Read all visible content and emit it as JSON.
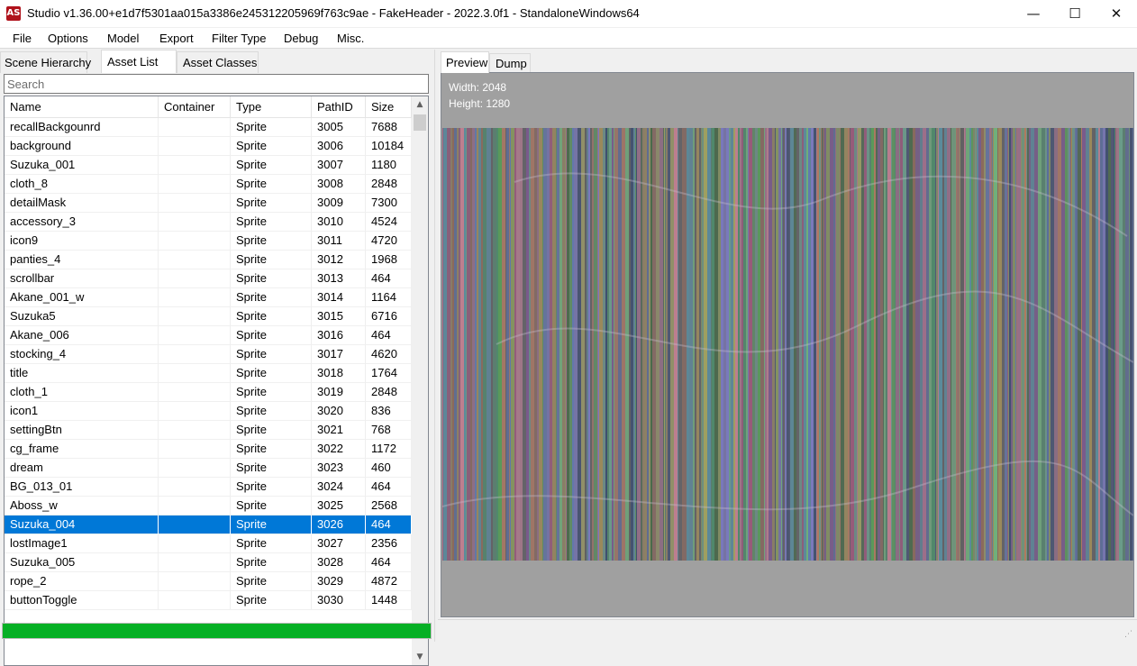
{
  "window": {
    "app_icon": "AS",
    "title": "Studio v1.36.00+e1d7f5301aa015a3386e245312205969f763c9ae - FakeHeader - 2022.3.0f1 - StandaloneWindows64",
    "minimize": "—",
    "maximize": "☐",
    "close": "✕"
  },
  "menu": [
    "File",
    "Options",
    "Model",
    "Export",
    "Filter Type",
    "Debug",
    "Misc."
  ],
  "left_tabs": [
    "Scene Hierarchy",
    "Asset List",
    "Asset Classes"
  ],
  "search": {
    "placeholder": "Search",
    "value": ""
  },
  "columns": [
    "Name",
    "Container",
    "Type",
    "PathID",
    "Size"
  ],
  "rows": [
    {
      "name": "recallBackgounrd",
      "container": "",
      "type": "Sprite",
      "pathid": "3005",
      "size": "7688"
    },
    {
      "name": "background",
      "container": "",
      "type": "Sprite",
      "pathid": "3006",
      "size": "10184"
    },
    {
      "name": "Suzuka_001",
      "container": "",
      "type": "Sprite",
      "pathid": "3007",
      "size": "1180"
    },
    {
      "name": "cloth_8",
      "container": "",
      "type": "Sprite",
      "pathid": "3008",
      "size": "2848"
    },
    {
      "name": "detailMask",
      "container": "",
      "type": "Sprite",
      "pathid": "3009",
      "size": "7300"
    },
    {
      "name": "accessory_3",
      "container": "",
      "type": "Sprite",
      "pathid": "3010",
      "size": "4524"
    },
    {
      "name": "icon9",
      "container": "",
      "type": "Sprite",
      "pathid": "3011",
      "size": "4720"
    },
    {
      "name": "panties_4",
      "container": "",
      "type": "Sprite",
      "pathid": "3012",
      "size": "1968"
    },
    {
      "name": "scrollbar",
      "container": "",
      "type": "Sprite",
      "pathid": "3013",
      "size": "464"
    },
    {
      "name": "Akane_001_w",
      "container": "",
      "type": "Sprite",
      "pathid": "3014",
      "size": "1164"
    },
    {
      "name": "Suzuka5",
      "container": "",
      "type": "Sprite",
      "pathid": "3015",
      "size": "6716"
    },
    {
      "name": "Akane_006",
      "container": "",
      "type": "Sprite",
      "pathid": "3016",
      "size": "464"
    },
    {
      "name": "stocking_4",
      "container": "",
      "type": "Sprite",
      "pathid": "3017",
      "size": "4620"
    },
    {
      "name": "title",
      "container": "",
      "type": "Sprite",
      "pathid": "3018",
      "size": "1764"
    },
    {
      "name": "cloth_1",
      "container": "",
      "type": "Sprite",
      "pathid": "3019",
      "size": "2848"
    },
    {
      "name": "icon1",
      "container": "",
      "type": "Sprite",
      "pathid": "3020",
      "size": "836"
    },
    {
      "name": "settingBtn",
      "container": "",
      "type": "Sprite",
      "pathid": "3021",
      "size": "768"
    },
    {
      "name": "cg_frame",
      "container": "",
      "type": "Sprite",
      "pathid": "3022",
      "size": "1172"
    },
    {
      "name": "dream",
      "container": "",
      "type": "Sprite",
      "pathid": "3023",
      "size": "460"
    },
    {
      "name": "BG_013_01",
      "container": "",
      "type": "Sprite",
      "pathid": "3024",
      "size": "464"
    },
    {
      "name": "Aboss_w",
      "container": "",
      "type": "Sprite",
      "pathid": "3025",
      "size": "2568"
    },
    {
      "name": "Suzuka_004",
      "container": "",
      "type": "Sprite",
      "pathid": "3026",
      "size": "464"
    },
    {
      "name": "lostImage1",
      "container": "",
      "type": "Sprite",
      "pathid": "3027",
      "size": "2356"
    },
    {
      "name": "Suzuka_005",
      "container": "",
      "type": "Sprite",
      "pathid": "3028",
      "size": "464"
    },
    {
      "name": "rope_2",
      "container": "",
      "type": "Sprite",
      "pathid": "3029",
      "size": "4872"
    },
    {
      "name": "buttonToggle",
      "container": "",
      "type": "Sprite",
      "pathid": "3030",
      "size": "1448"
    }
  ],
  "selected_row": 21,
  "scroll": {
    "up": "▲",
    "down": "▼"
  },
  "progress_fraction": 1.0,
  "progress_color": "#06b025",
  "right_tabs": [
    "Preview",
    "Dump"
  ],
  "preview": {
    "width_label": "Width: 2048",
    "height_label": "Height: 1280"
  },
  "status": {
    "grip": "⋰"
  }
}
